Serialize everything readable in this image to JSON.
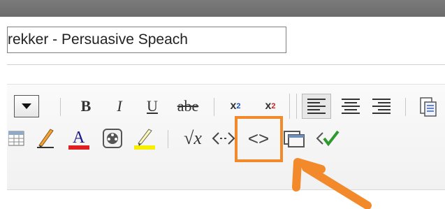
{
  "window": {
    "top_bar_color": "#6f6f6f"
  },
  "title_field": {
    "value": "rekker - Persuasive Speach"
  },
  "toolbar": {
    "row1": {
      "bold": "B",
      "italic": "I",
      "underline": "U",
      "strikethrough": "abe",
      "subscript_base": "x",
      "subscript_mark": "2",
      "superscript_base": "x",
      "superscript_mark": "2"
    },
    "row2": {
      "math": "√x",
      "code": "<>"
    }
  },
  "colors": {
    "highlight_border": "#f28a2c",
    "font_color_bar": "#e02020",
    "highlight_color_bar": "#f6f000",
    "accent_check": "#2e9a2e"
  },
  "icons": [
    "table-icon",
    "pencil-icon",
    "font-color-icon",
    "media-icon",
    "highlighter-icon",
    "math-icon",
    "anchor-icon",
    "code-icon",
    "window-icon",
    "spellcheck-icon",
    "paste-icon"
  ]
}
